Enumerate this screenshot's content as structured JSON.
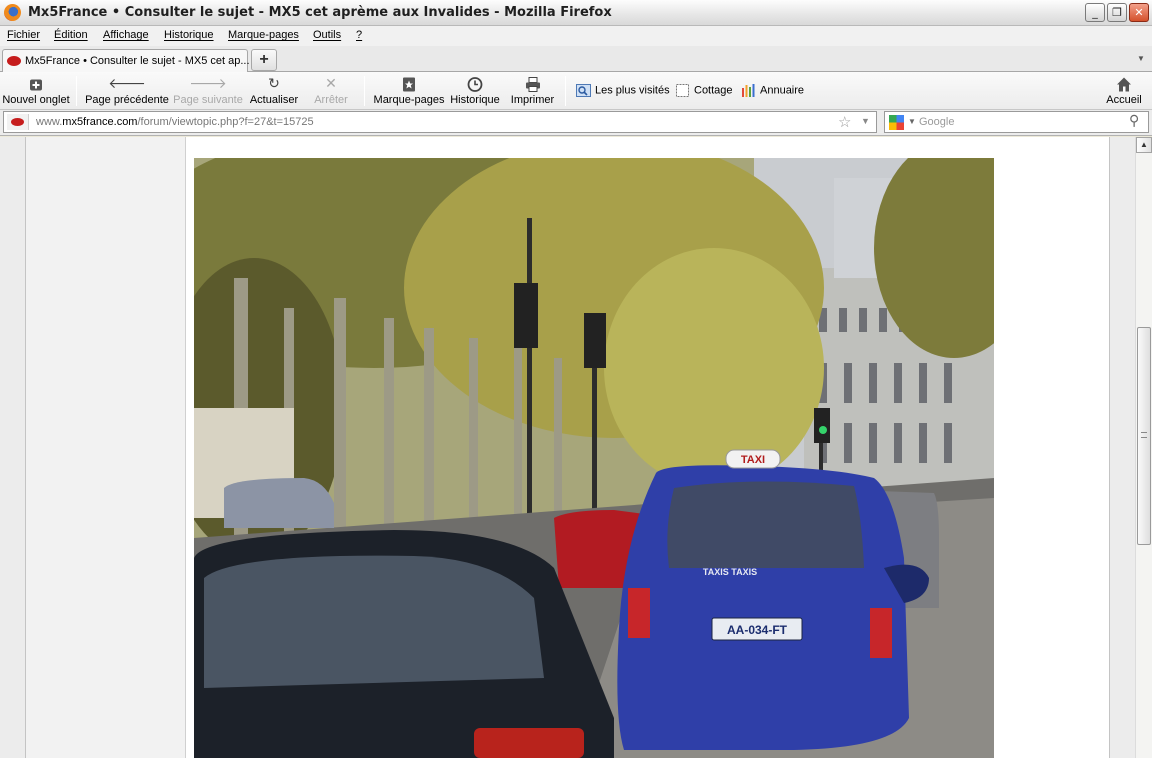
{
  "window": {
    "title": "Mx5France • Consulter le sujet - MX5 cet aprème aux Invalides - Mozilla Firefox",
    "min_label": "_",
    "max_label": "❐",
    "close_label": "✕"
  },
  "menu": {
    "items": [
      {
        "label": "Fichier"
      },
      {
        "label": "Édition"
      },
      {
        "label": "Affichage"
      },
      {
        "label": "Historique"
      },
      {
        "label": "Marque-pages"
      },
      {
        "label": "Outils"
      },
      {
        "label": "?"
      }
    ]
  },
  "tabs": {
    "active": {
      "label": "Mx5France • Consulter le sujet - MX5 cet ap..."
    },
    "new_tab_label": "+",
    "list_label": "▼"
  },
  "toolbar": {
    "new_tab": {
      "label": "Nouvel onglet",
      "icon": "new-tab-icon"
    },
    "back": {
      "label": "Page précédente",
      "icon": "back-arrow-icon"
    },
    "forward": {
      "label": "Page suivante",
      "icon": "forward-arrow-icon",
      "disabled": true
    },
    "reload": {
      "label": "Actualiser",
      "icon": "reload-icon"
    },
    "stop": {
      "label": "Arrêter",
      "icon": "stop-icon",
      "disabled": true
    },
    "bookmarks": {
      "label": "Marque-pages",
      "icon": "bookmark-icon"
    },
    "history": {
      "label": "Historique",
      "icon": "clock-icon"
    },
    "print": {
      "label": "Imprimer",
      "icon": "printer-icon"
    },
    "home": {
      "label": "Accueil",
      "icon": "home-icon"
    }
  },
  "bookmarks_bar": [
    {
      "label": "Les plus visités",
      "icon": "most-visited-icon"
    },
    {
      "label": "Cottage",
      "icon": "page-icon"
    },
    {
      "label": "Annuaire",
      "icon": "directory-icon"
    }
  ],
  "urlbar": {
    "prefix": "www.",
    "domain": "mx5france.com",
    "path": "/forum/viewtopic.php?f=27&t=15725"
  },
  "search": {
    "placeholder": "Google",
    "engine_icon": "google-icon"
  },
  "content": {
    "photo_description_alt": "",
    "taxi_sign": "TAXI",
    "taxi_door_text": "TAXIS TAXIS",
    "plate": "AA-034-FT"
  },
  "colors": {
    "chrome_bg": "#ececec",
    "taxi_blue": "#2f3fa8"
  }
}
